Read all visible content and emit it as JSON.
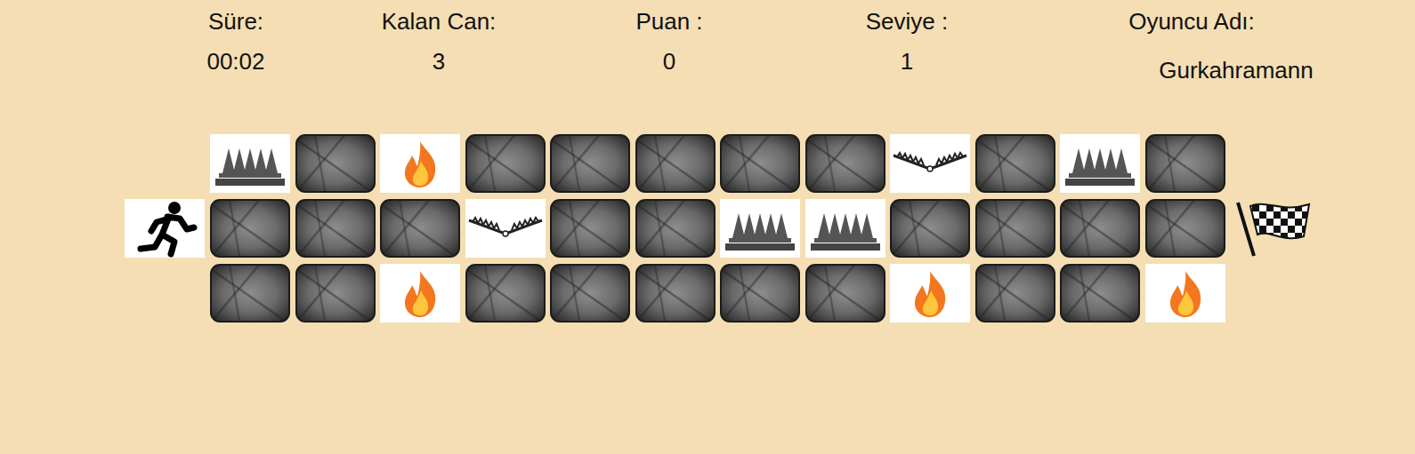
{
  "stats": [
    {
      "label": "Süre:",
      "value": "00:02"
    },
    {
      "label": "Kalan Can:",
      "value": "3"
    },
    {
      "label": "Puan :",
      "value": "0"
    },
    {
      "label": "Seviye :",
      "value": "1"
    }
  ],
  "player": {
    "label": "Oyuncu Adı:",
    "name": "Gurkahramann"
  },
  "board": {
    "rows": [
      [
        {
          "kind": "spike"
        },
        {
          "kind": "stone"
        },
        {
          "kind": "fire"
        },
        {
          "kind": "stone"
        },
        {
          "kind": "stone"
        },
        {
          "kind": "stone"
        },
        {
          "kind": "stone"
        },
        {
          "kind": "stone"
        },
        {
          "kind": "trap"
        },
        {
          "kind": "stone"
        },
        {
          "kind": "spike"
        },
        {
          "kind": "stone"
        }
      ],
      [
        {
          "kind": "stone"
        },
        {
          "kind": "stone"
        },
        {
          "kind": "stone"
        },
        {
          "kind": "trap"
        },
        {
          "kind": "stone"
        },
        {
          "kind": "stone"
        },
        {
          "kind": "spike"
        },
        {
          "kind": "spike"
        },
        {
          "kind": "stone"
        },
        {
          "kind": "stone"
        },
        {
          "kind": "stone"
        },
        {
          "kind": "stone"
        }
      ],
      [
        {
          "kind": "stone"
        },
        {
          "kind": "stone"
        },
        {
          "kind": "fire"
        },
        {
          "kind": "stone"
        },
        {
          "kind": "stone"
        },
        {
          "kind": "stone"
        },
        {
          "kind": "stone"
        },
        {
          "kind": "stone"
        },
        {
          "kind": "fire"
        },
        {
          "kind": "stone"
        },
        {
          "kind": "stone"
        },
        {
          "kind": "fire"
        }
      ]
    ]
  }
}
